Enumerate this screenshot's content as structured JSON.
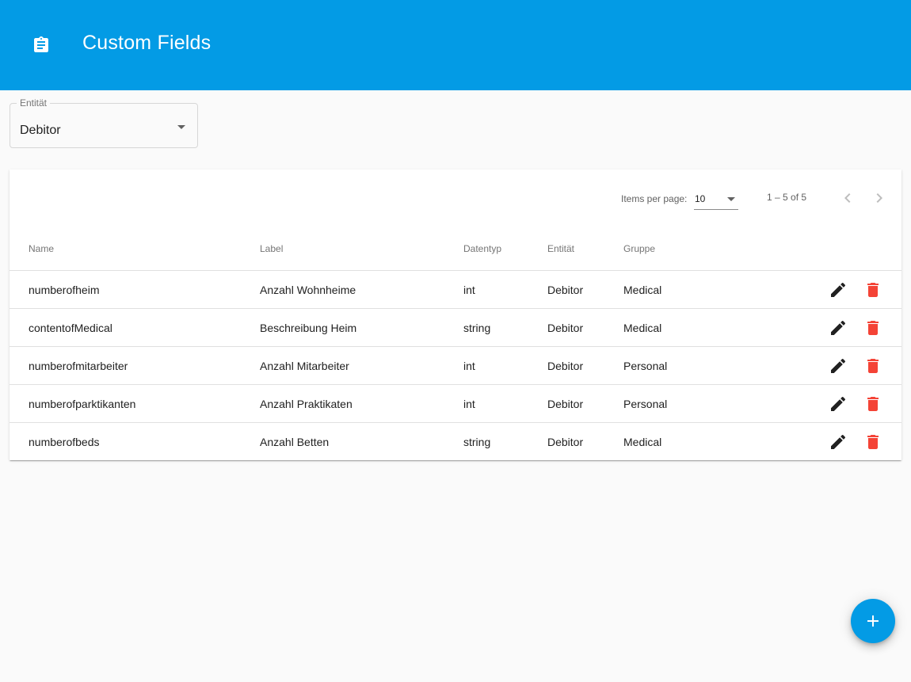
{
  "header": {
    "title": "Custom Fields",
    "icon": "assignment-icon",
    "color": "#039be5"
  },
  "filter": {
    "label": "Entität",
    "value": "Debitor"
  },
  "paginator": {
    "items_per_page_label": "Items per page:",
    "items_per_page_value": "10",
    "range_label": "1 – 5 of 5"
  },
  "table": {
    "columns": [
      "Name",
      "Label",
      "Datentyp",
      "Entität",
      "Gruppe"
    ],
    "rows": [
      {
        "name": "numberofheim",
        "label": "Anzahl Wohnheime",
        "type": "int",
        "entity": "Debitor",
        "group": "Medical"
      },
      {
        "name": "contentofMedical",
        "label": "Beschreibung Heim",
        "type": "string",
        "entity": "Debitor",
        "group": "Medical"
      },
      {
        "name": "numberofmitarbeiter",
        "label": "Anzahl Mitarbeiter",
        "type": "int",
        "entity": "Debitor",
        "group": "Personal"
      },
      {
        "name": "numberofparktikanten",
        "label": "Anzahl Praktikaten",
        "type": "int",
        "entity": "Debitor",
        "group": "Personal"
      },
      {
        "name": "numberofbeds",
        "label": "Anzahl Betten",
        "type": "string",
        "entity": "Debitor",
        "group": "Medical"
      }
    ],
    "row_actions": {
      "edit_icon": "edit-icon",
      "delete_icon": "delete-icon",
      "delete_color": "#f44336"
    }
  },
  "fab": {
    "icon": "add-icon"
  }
}
